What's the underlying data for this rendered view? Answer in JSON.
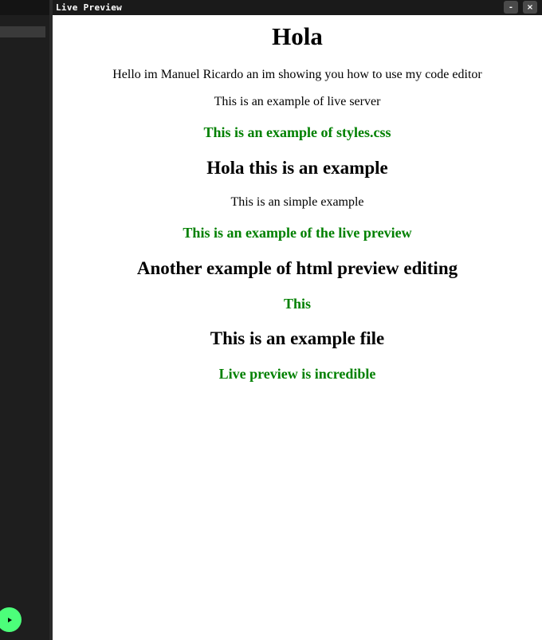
{
  "window": {
    "title": "Live Preview",
    "minimize_label": "-",
    "close_label": "×"
  },
  "colors": {
    "accent_green_text": "#008000",
    "run_button": "#4cff7a",
    "editor_background": "#1e1e1e"
  },
  "preview": {
    "heading": "Hola",
    "intro": "Hello im Manuel Ricardo an im showing you how to use my code editor",
    "live_server_text": "This is an example of live server",
    "styles_heading": "This is an example of styles.css",
    "example_heading": "Hola this is an example",
    "simple_example_text": "This is an simple example",
    "live_preview_heading": "This is an example of the live preview",
    "editing_heading": "Another example of html preview editing",
    "this_heading": "This",
    "example_file_heading": "This is an example file",
    "incredible_heading": "Live preview is incredible"
  },
  "sidebar": {
    "run_icon": "play-icon"
  }
}
